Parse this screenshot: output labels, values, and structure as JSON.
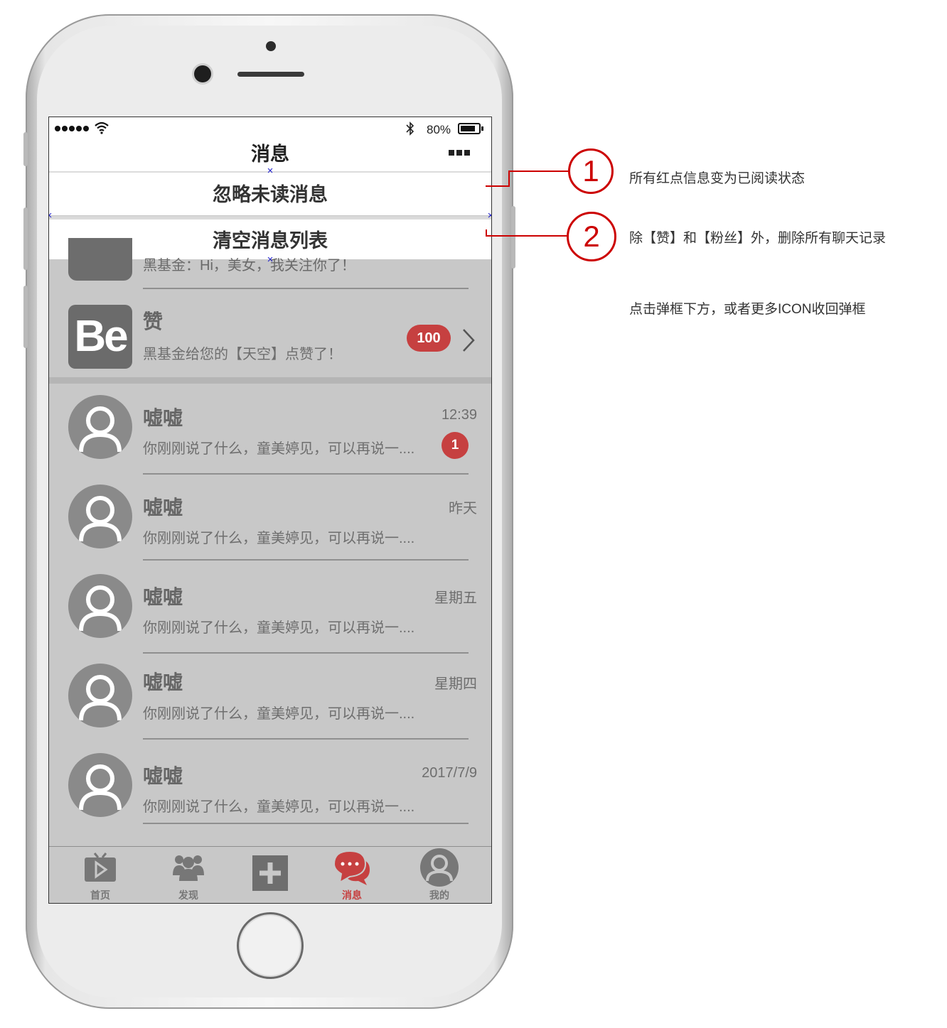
{
  "status_bar": {
    "battery_percent": "80%"
  },
  "nav": {
    "title": "消息"
  },
  "menu": {
    "item1": "忽略未读消息",
    "item2": "清空消息列表"
  },
  "peek_row": {
    "text": "黑基金：Hi，美女，我关注你了！"
  },
  "zan_row": {
    "logo": "Be",
    "title": "赞",
    "subtitle": "黑基金给您的【天空】点赞了！",
    "badge": "100"
  },
  "messages": [
    {
      "name": "嘘嘘",
      "preview": "你刚刚说了什么，童美婷见，可以再说一....",
      "time": "12:39",
      "badge": "1"
    },
    {
      "name": "嘘嘘",
      "preview": "你刚刚说了什么，童美婷见，可以再说一....",
      "time": "昨天"
    },
    {
      "name": "嘘嘘",
      "preview": "你刚刚说了什么，童美婷见，可以再说一....",
      "time": "星期五"
    },
    {
      "name": "嘘嘘",
      "preview": "你刚刚说了什么，童美婷见，可以再说一....",
      "time": "星期四"
    },
    {
      "name": "嘘嘘",
      "preview": "你刚刚说了什么，童美婷见，可以再说一....",
      "time": "2017/7/9"
    }
  ],
  "tabs": [
    {
      "label": "首页",
      "icon": "tv-icon"
    },
    {
      "label": "发现",
      "icon": "group-icon"
    },
    {
      "label": "",
      "icon": "plus-icon"
    },
    {
      "label": "消息",
      "icon": "chat-icon",
      "active": true
    },
    {
      "label": "我的",
      "icon": "user-icon"
    }
  ],
  "annotations": [
    {
      "number": "1",
      "text": "所有红点信息变为已阅读状态"
    },
    {
      "number": "2",
      "text": "除【赞】和【粉丝】外，删除所有聊天记录"
    },
    {
      "text": "点击弹框下方，或者更多ICON收回弹框"
    }
  ],
  "colors": {
    "accent": "#c64040",
    "annotation": "#cc0000",
    "overlay": "#c8c8c8"
  }
}
